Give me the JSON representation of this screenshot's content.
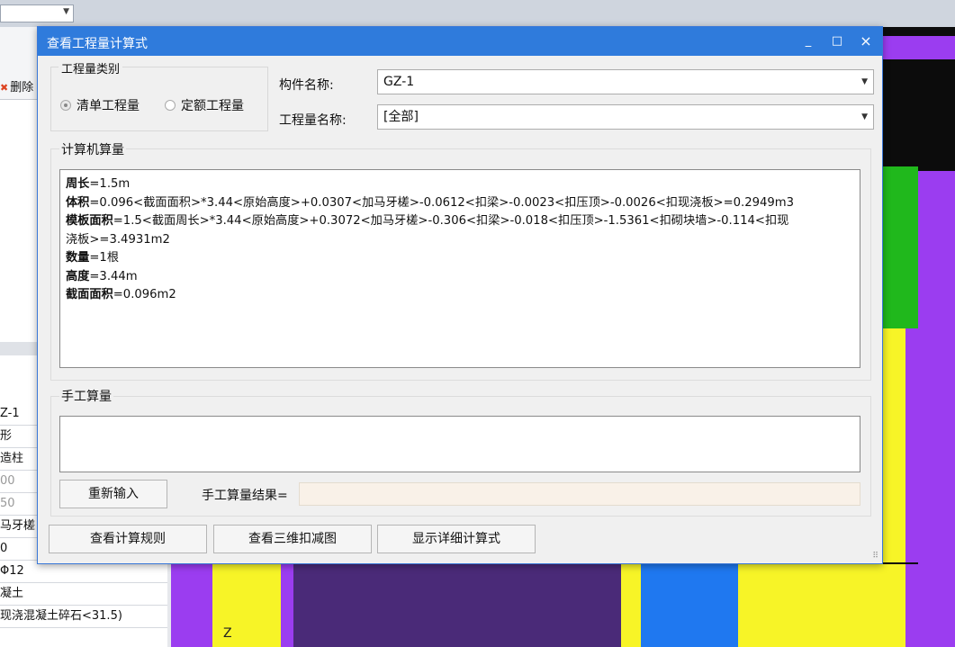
{
  "background": {
    "left_panel": {
      "delete_label": "删除",
      "property_rows": [
        "Z-1",
        "形",
        "造柱",
        "00",
        "50",
        "马牙槎",
        "0",
        "Φ12",
        "凝土",
        "现浇混凝土碎石<31.5)"
      ]
    },
    "canvas_axis_label": "Z"
  },
  "dialog": {
    "title": "查看工程量计算式",
    "window_controls": {
      "minimize": "_",
      "maximize": "□",
      "close": "×"
    },
    "quantity_type": {
      "legend": "工程量类别",
      "options": [
        {
          "label": "清单工程量",
          "selected": true
        },
        {
          "label": "定额工程量",
          "selected": false
        }
      ]
    },
    "component_name": {
      "label": "构件名称:",
      "value": "GZ-1"
    },
    "quantity_name": {
      "label": "工程量名称:",
      "value": "[全部]"
    },
    "computer_calc": {
      "title": "计算机算量",
      "lines": [
        {
          "key": "周长",
          "rest": "=1.5m"
        },
        {
          "key": "体积",
          "rest": "=0.096<截面面积>*3.44<原始高度>+0.0307<加马牙槎>-0.0612<扣梁>-0.0023<扣压顶>-0.0026<扣现浇板>=0.2949m3"
        },
        {
          "key": "模板面积",
          "rest": "=1.5<截面周长>*3.44<原始高度>+0.3072<加马牙槎>-0.306<扣梁>-0.018<扣压顶>-1.5361<扣砌块墙>-0.114<扣现"
        },
        {
          "key": "",
          "rest": "浇板>=3.4931m2"
        },
        {
          "key": "数量",
          "rest": "=1根"
        },
        {
          "key": "高度",
          "rest": "=3.44m"
        },
        {
          "key": "截面面积",
          "rest": "=0.096m2"
        }
      ]
    },
    "manual_calc": {
      "title": "手工算量",
      "reenter_button": "重新输入",
      "result_label": "手工算量结果=",
      "result_value": ""
    },
    "bottom_buttons": {
      "view_rules": "查看计算规则",
      "view_3d": "查看三维扣减图",
      "show_detail": "显示详细计算式"
    }
  },
  "colors": {
    "title_bar": "#2f7bdc",
    "canvas_black": "#0c0c0c",
    "canvas_purple": "#9b3df0",
    "canvas_dark_purple": "#4a2a78",
    "canvas_yellow": "#f7f427",
    "canvas_blue": "#1f78f0",
    "canvas_green": "#20b81c"
  }
}
